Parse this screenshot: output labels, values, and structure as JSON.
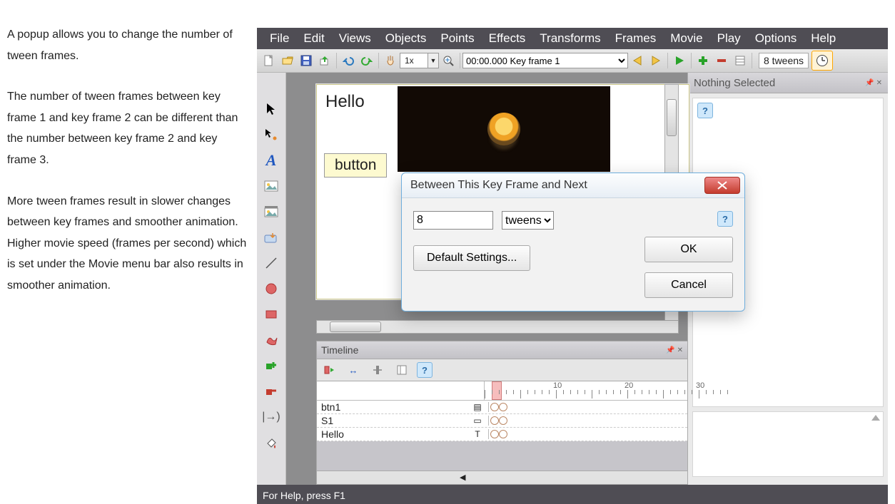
{
  "help_text": {
    "p1": "A popup allows you to change the number of tween frames.",
    "p2": "The number of tween frames between key frame 1 and key frame 2 can be different than the number between key frame 2 and key frame 3.",
    "p3": "More tween frames result in slower changes between key frames and smoother animation. Higher movie speed (frames per second) which is set under the Movie menu bar also results in smoother animation."
  },
  "menu": {
    "file": "File",
    "edit": "Edit",
    "views": "Views",
    "objects": "Objects",
    "points": "Points",
    "effects": "Effects",
    "transforms": "Transforms",
    "frames": "Frames",
    "movie": "Movie",
    "play": "Play",
    "options": "Options",
    "help": "Help"
  },
  "toolbar": {
    "speed": "1x",
    "time": "00:00.000",
    "frame": "Key frame 1",
    "tweens": "8 tweens"
  },
  "canvas": {
    "hello": "Hello",
    "button": "button"
  },
  "timeline": {
    "title": "Timeline",
    "rows": [
      {
        "name": "btn1",
        "type": "▤"
      },
      {
        "name": "S1",
        "type": "▭"
      },
      {
        "name": "Hello",
        "type": "T"
      }
    ],
    "ruler": {
      "t10": "10",
      "t20": "20",
      "t30": "30"
    }
  },
  "right_panel": {
    "title": "Nothing Selected"
  },
  "dialog": {
    "title": "Between This Key Frame and Next",
    "value": "8",
    "unit": "tweens",
    "default": "Default Settings...",
    "ok": "OK",
    "cancel": "Cancel"
  },
  "status": "For Help, press F1"
}
